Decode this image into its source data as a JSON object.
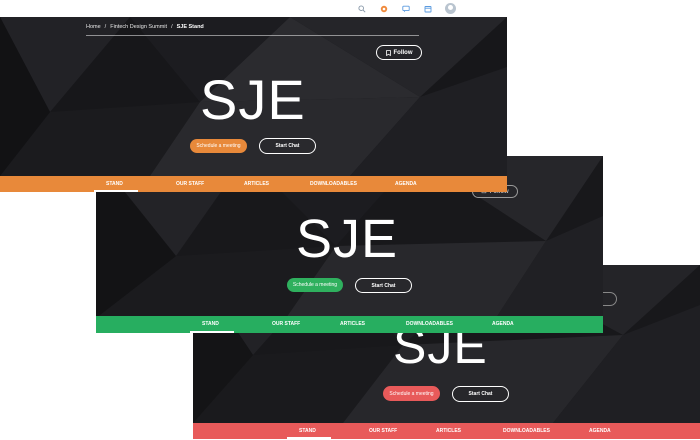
{
  "breadcrumb": {
    "home": "Home",
    "sep1": "/",
    "event": "Fintech Design Summit",
    "sep2": "/",
    "current": "SJE Stand"
  },
  "follow_label": "Follow",
  "logo_text": "SJE",
  "buttons": {
    "schedule": "Schedule a meeting",
    "chat": "Start Chat"
  },
  "tabs": [
    "STAND",
    "OUR STAFF",
    "ARTICLES",
    "DOWNLOADABLES",
    "AGENDA"
  ],
  "icons": [
    "search-icon",
    "notification-icon",
    "chat-icon",
    "calendar-icon",
    "avatar"
  ],
  "variants": [
    {
      "name": "orange",
      "accent": "#e8893a",
      "tabbar": "#e8893a"
    },
    {
      "name": "green",
      "accent": "#2fb05e",
      "tabbar": "#27ae60"
    },
    {
      "name": "red",
      "accent": "#e85a5a",
      "tabbar": "#e85a5a"
    }
  ]
}
